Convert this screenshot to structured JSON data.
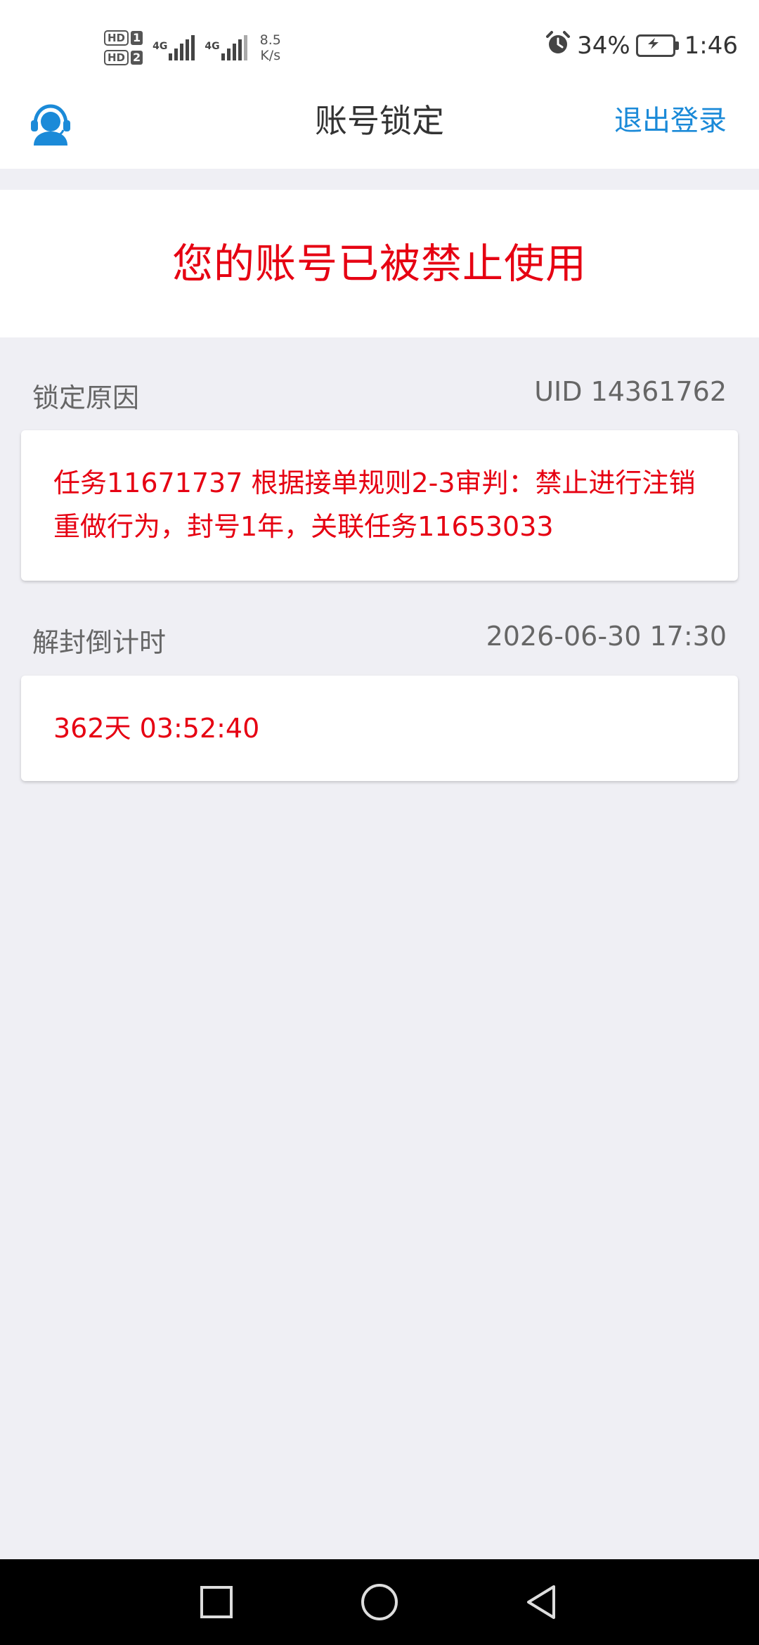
{
  "status_bar": {
    "hd1": "HD",
    "sim1": "1",
    "hd2": "HD",
    "sim2": "2",
    "net1": "4G",
    "net2": "4G",
    "speed_value": "8.5",
    "speed_unit": "K/s",
    "battery_percent": "34%",
    "time": "1:46"
  },
  "header": {
    "title": "账号锁定",
    "logout_label": "退出登录",
    "support_icon": "customer-service-icon"
  },
  "banner": {
    "message": "您的账号已被禁止使用"
  },
  "lock_reason": {
    "label": "锁定原因",
    "uid": "UID 14361762",
    "text": "任务11671737 根据接单规则2-3审判：禁止进行注销重做行为，封号1年，关联任务11653033"
  },
  "unlock": {
    "label": "解封倒计时",
    "unlock_time": "2026-06-30 17:30",
    "countdown": "362天 03:52:40"
  },
  "nav_bar": {
    "recent_icon": "square-icon",
    "home_icon": "circle-icon",
    "back_icon": "triangle-back-icon"
  },
  "colors": {
    "accent_blue": "#1b8ad8",
    "alert_red": "#e60012",
    "background": "#efeff4"
  }
}
